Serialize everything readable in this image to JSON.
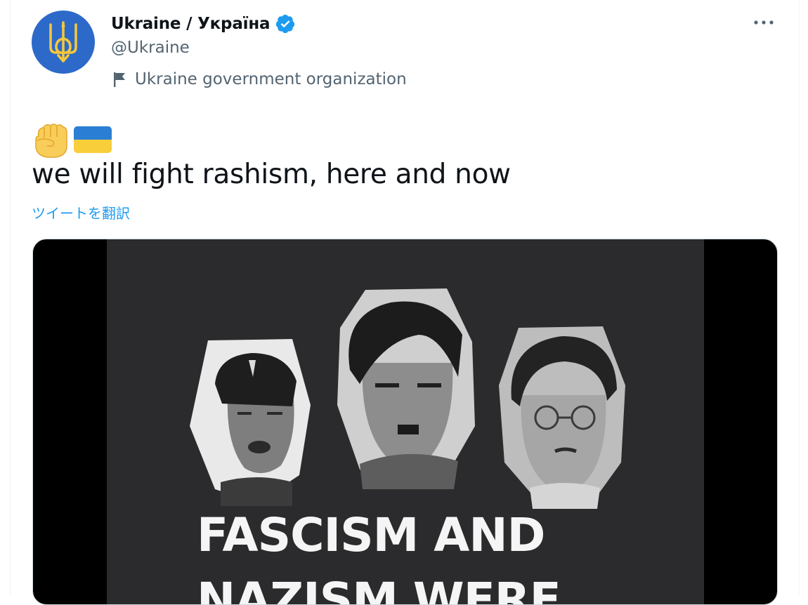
{
  "account": {
    "display_name": "Ukraine / Україна",
    "handle": "@Ukraine",
    "affiliation": "Ukraine government organization",
    "verified": true
  },
  "icons": {
    "avatar": "ukraine-trident-icon",
    "verified": "verified-badge-icon",
    "affiliation": "flag-icon",
    "more": "more-dots-icon",
    "emoji_1": "raised-fist-icon",
    "emoji_2": "ukraine-flag-icon"
  },
  "tweet": {
    "text": "we will fight rashism, here and now",
    "translate_label": "ツイートを翻訳"
  },
  "media": {
    "headline_line1": "FASCISM AND",
    "headline_line2": "NAZISM WERE"
  },
  "colors": {
    "accent": "#1d9bf0",
    "avatar_bg": "#2c69c9",
    "trident": "#f4c73b",
    "secondary_text": "#536471",
    "flag_blue": "#2a7fd4",
    "flag_yellow": "#f8cf3a"
  }
}
